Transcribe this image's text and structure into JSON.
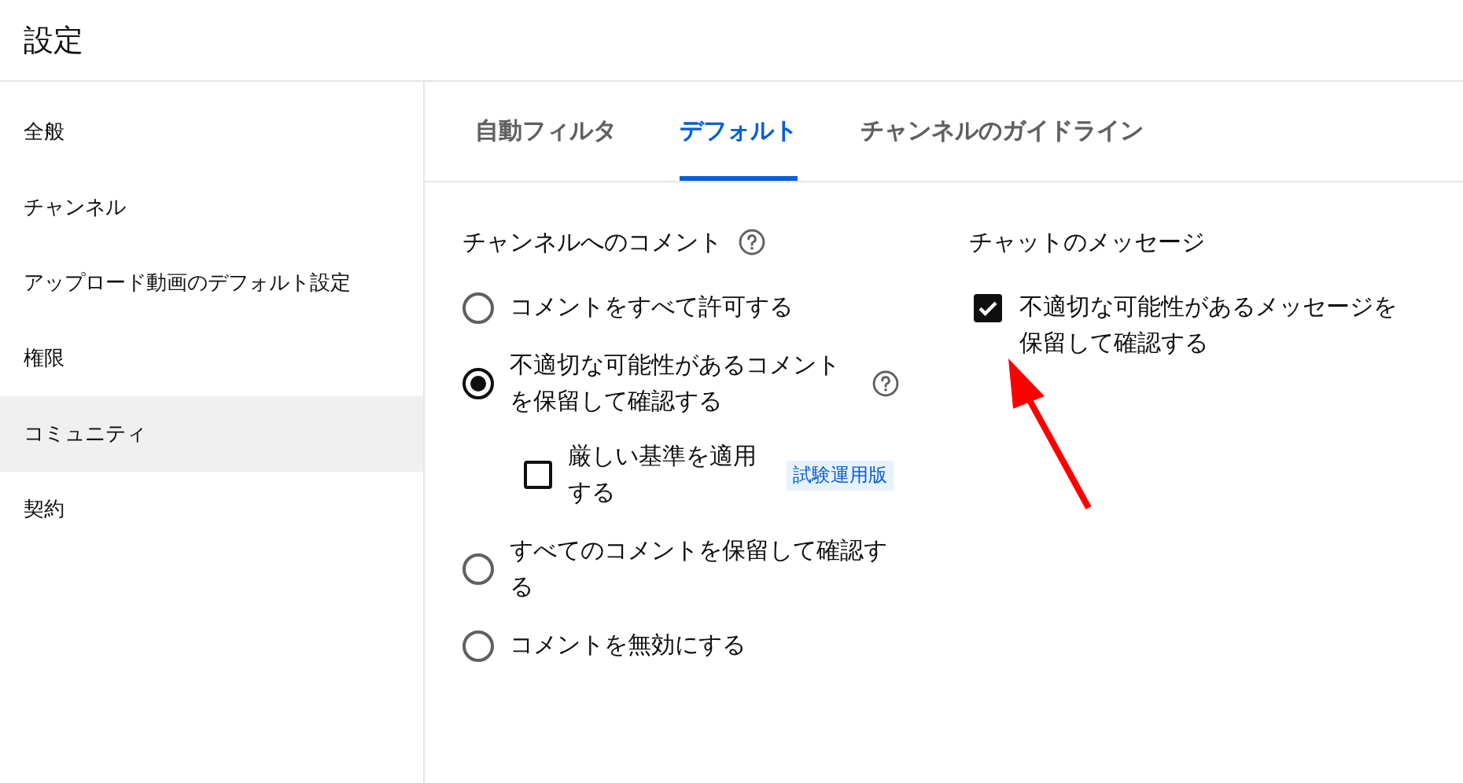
{
  "header": {
    "title": "設定"
  },
  "sidebar": {
    "items": [
      {
        "label": "全般",
        "selected": false
      },
      {
        "label": "チャンネル",
        "selected": false
      },
      {
        "label": "アップロード動画のデフォルト設定",
        "selected": false
      },
      {
        "label": "権限",
        "selected": false
      },
      {
        "label": "コミュニティ",
        "selected": true
      },
      {
        "label": "契約",
        "selected": false
      }
    ]
  },
  "tabs": [
    {
      "label": "自動フィルタ",
      "selected": false
    },
    {
      "label": "デフォルト",
      "selected": true
    },
    {
      "label": "チャンネルのガイドライン",
      "selected": false
    }
  ],
  "channel_comments": {
    "title": "チャンネルへのコメント",
    "options": [
      {
        "label": "コメントをすべて許可する",
        "selected": false,
        "help": false
      },
      {
        "label": "不適切な可能性があるコメントを保留して確認する",
        "selected": true,
        "help": true,
        "sub_option": {
          "label": "厳しい基準を適用する",
          "checked": false,
          "badge": "試験運用版"
        }
      },
      {
        "label": "すべてのコメントを保留して確認する",
        "selected": false,
        "help": false
      },
      {
        "label": "コメントを無効にする",
        "selected": false,
        "help": false
      }
    ]
  },
  "chat_messages": {
    "title": "チャットのメッセージ",
    "option": {
      "label": "不適切な可能性があるメッセージを保留して確認する",
      "checked": true
    }
  }
}
